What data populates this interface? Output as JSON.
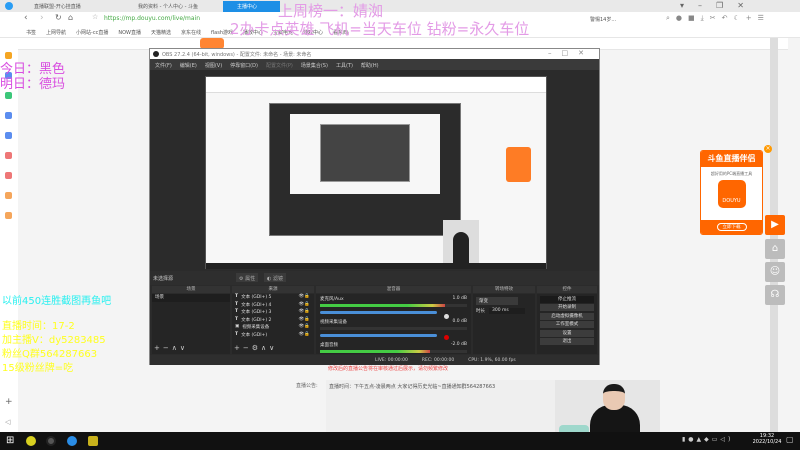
{
  "browser": {
    "tabs": [
      {
        "label": "直播联盟-开心挂直播"
      },
      {
        "label": "我的资料 - 个人中心 - 斗鱼"
      },
      {
        "label": "主播中心"
      }
    ],
    "url": "https://mp.douyu.com/live/main",
    "search_hint": "警惕14岁...",
    "bookmarks": [
      "书签",
      "上网导航",
      "小网站-cc直播",
      "NOW直播",
      "天猫精选",
      "京东在线",
      "flash游戏",
      "播放中心",
      "宝藏电竞",
      "游戏中心",
      "看东西"
    ]
  },
  "overlays": {
    "top_rank": "上周榜一：婧洳",
    "car_info": "2办卡点英雄 飞机=当天车位 钻粉=永久车位",
    "today": "今日：黑色",
    "tomorrow": "明日：德玛",
    "cyan_note": "以前450连胜截图再鱼吧",
    "yellow_lines": [
      "直播时间：17-2",
      "加主播V：dy5283485",
      "粉丝Q群564287663",
      "15级粉丝牌=吃"
    ]
  },
  "obs": {
    "title": "OBS 27.2.4 (64-bit, windows) - 配置文件: 未命名 - 场景: 未命名",
    "menu": [
      "文件(F)",
      "编辑(E)",
      "视图(V)",
      "停靠窗口(D)",
      "配置文件(P)",
      "场景集合(S)",
      "工具(T)",
      "帮助(H)"
    ],
    "no_source": "未选择源",
    "props_btn": "属性",
    "filters_btn": "滤镜",
    "docks": {
      "scenes": "场景",
      "sources": "来源",
      "mixer": "混音器",
      "transitions": "转场特效",
      "controls": "控件"
    },
    "scenes": [
      "场景"
    ],
    "sources": [
      "文本 (GDI+) 5",
      "文本 (GDI+) 4",
      "文本 (GDI+) 3",
      "文本 (GDI+) 2",
      "视频采集设备",
      "文本 (GDI+)"
    ],
    "mixer": [
      {
        "name": "麦克风/Aux",
        "db": "1.0 dB",
        "level": 0.85
      },
      {
        "name": "视频采集设备",
        "db": "0.0 dB",
        "level": 0.0
      },
      {
        "name": "桌面音频",
        "db": "-2.0 dB",
        "level": 0.75
      }
    ],
    "transition": {
      "type": "渐变",
      "duration_label": "时长",
      "duration": "300 ms"
    },
    "controls": [
      "停止推流",
      "开始录制",
      "启动虚拟摄像机",
      "工作室模式",
      "设置",
      "退出"
    ],
    "status": {
      "live": "LIVE: 00:00:00",
      "rec": "REC: 00:00:00",
      "cpu": "CPU: 1.9%, 60.00 fps"
    }
  },
  "page": {
    "warning": "修改后的直播公告将在审核通过后展示，请勿频繁修改",
    "announce_label": "直播公告:",
    "announce_text": "直播时间：下午五点-凌晨两点 大家记得历史光临~直播通知群564287663"
  },
  "promo": {
    "title": "斗鱼直播伴侣",
    "subtitle": "超好用的PC端直播工具",
    "logo": "DOUYU",
    "button": "立即下载"
  },
  "taskbar": {
    "time": "19:32",
    "date": "2022/10/24"
  }
}
